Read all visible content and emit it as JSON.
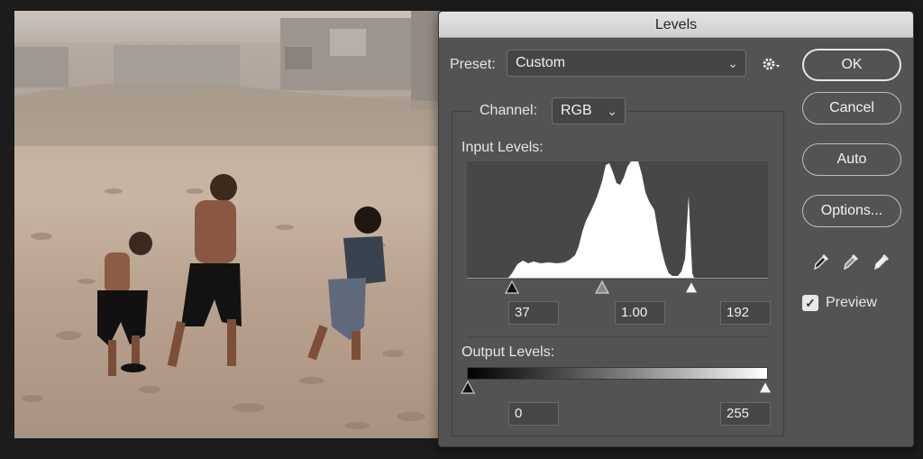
{
  "dialog": {
    "title": "Levels",
    "preset": {
      "label": "Preset:",
      "value": "Custom"
    },
    "channel": {
      "label": "Channel:",
      "value": "RGB"
    },
    "input_levels": {
      "label": "Input Levels:",
      "black": "37",
      "gamma": "1.00",
      "white": "192"
    },
    "output_levels": {
      "label": "Output Levels:",
      "black": "0",
      "white": "255"
    },
    "buttons": {
      "ok": "OK",
      "cancel": "Cancel",
      "auto": "Auto",
      "options": "Options..."
    },
    "preview": {
      "label": "Preview",
      "checked": true
    },
    "icons": [
      "gear-icon",
      "black-point-eyedropper-icon",
      "gray-point-eyedropper-icon",
      "white-point-eyedropper-icon"
    ]
  }
}
